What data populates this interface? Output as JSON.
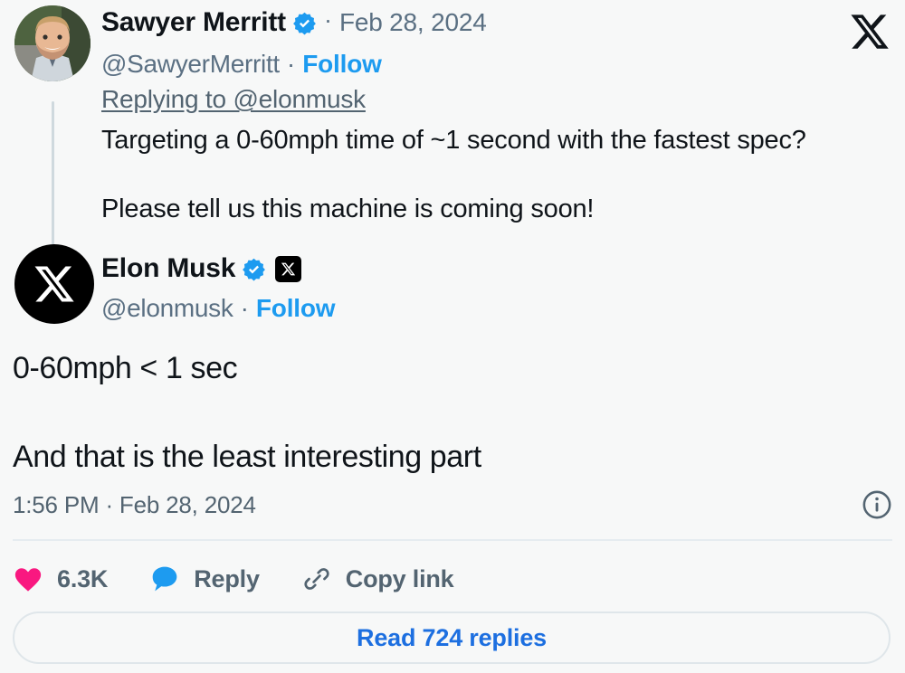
{
  "brand": {
    "logo_icon": "x-logo",
    "accent_blue": "#1d9bf0",
    "link_blue": "#1d6fe0",
    "like_pink": "#f91880",
    "text_primary": "#0f1419",
    "text_secondary": "#536471",
    "background": "#f7f8f8"
  },
  "reply_tweet": {
    "avatar_icon": "user-avatar-photo",
    "display_name": "Sawyer Merritt",
    "verified_icon": "verified-badge-icon",
    "separator": "·",
    "date": "Feb 28, 2024",
    "handle": "@SawyerMerritt",
    "follow_label": "Follow",
    "replying_to": "Replying to @elonmusk",
    "body_line_1": "Targeting a 0-60mph time of ~1 second with the fastest spec?",
    "body_line_2": "Please tell us this machine is coming soon!"
  },
  "main_tweet": {
    "avatar_icon": "x-logo-avatar",
    "display_name": "Elon Musk",
    "verified_icon": "verified-badge-icon",
    "affiliate_icon": "x-affiliate-badge-icon",
    "handle": "@elonmusk",
    "separator": "·",
    "follow_label": "Follow",
    "body_line_1": "0-60mph < 1 sec",
    "body_line_2": "And that is the least interesting part",
    "timestamp": "1:56 PM · Feb 28, 2024",
    "info_icon": "info-circle-icon"
  },
  "actions": {
    "like": {
      "icon": "heart-icon",
      "count": "6.3K"
    },
    "reply": {
      "icon": "speech-bubble-icon",
      "label": "Reply"
    },
    "copy_link": {
      "icon": "chain-link-icon",
      "label": "Copy link"
    }
  },
  "footer": {
    "read_replies_label": "Read 724 replies"
  }
}
